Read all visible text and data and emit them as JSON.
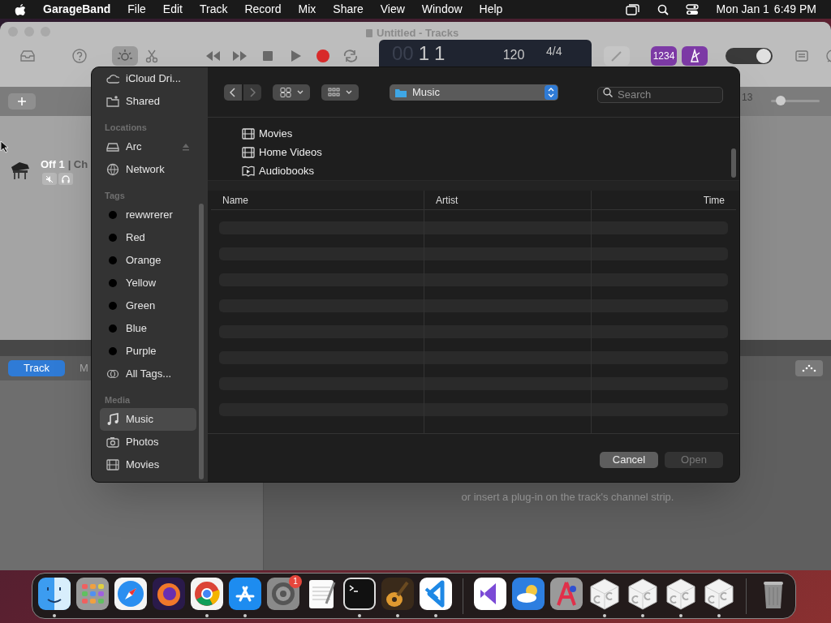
{
  "menubar": {
    "app": "GarageBand",
    "menus": [
      "File",
      "Edit",
      "Track",
      "Record",
      "Mix",
      "Share",
      "View",
      "Window",
      "Help"
    ],
    "date": "Mon Jan 1",
    "time": "6:49 PM"
  },
  "window": {
    "title": "Untitled - Tracks"
  },
  "lcd": {
    "bars_dim": "00",
    "bar": "1",
    "beat": "1",
    "tempo": "120",
    "signature": "4/4"
  },
  "count_in": "1234",
  "toggle": {
    "on": true
  },
  "zoom": {
    "level": 0.12
  },
  "ruler": {
    "bar": "13"
  },
  "track": {
    "name": "Off 1",
    "extra": "| Ch"
  },
  "editor_tabs": [
    {
      "label": "Track",
      "selected": true
    },
    {
      "label": "M",
      "selected": false
    }
  ],
  "editor_hint": "or insert a plug-in on the track's channel strip.",
  "dialog": {
    "sidebar": [
      {
        "items": [
          {
            "kind": "cloud",
            "label": "iCloud Dri...",
            "selected": false
          },
          {
            "kind": "shared",
            "label": "Shared",
            "selected": false
          }
        ]
      },
      {
        "heading": "Locations",
        "items": [
          {
            "kind": "disk",
            "label": "Arc",
            "selected": false,
            "eject": true
          },
          {
            "kind": "network",
            "label": "Network",
            "selected": false
          }
        ]
      },
      {
        "heading": "Tags",
        "items": [
          {
            "kind": "tag",
            "label": "rewwrerer",
            "selected": false
          },
          {
            "kind": "tag",
            "label": "Red",
            "selected": false
          },
          {
            "kind": "tag",
            "label": "Orange",
            "selected": false
          },
          {
            "kind": "tag",
            "label": "Yellow",
            "selected": false
          },
          {
            "kind": "tag",
            "label": "Green",
            "selected": false
          },
          {
            "kind": "tag",
            "label": "Blue",
            "selected": false
          },
          {
            "kind": "tag",
            "label": "Purple",
            "selected": false
          },
          {
            "kind": "alltags",
            "label": "All Tags...",
            "selected": false
          }
        ]
      },
      {
        "heading": "Media",
        "items": [
          {
            "kind": "music",
            "label": "Music",
            "selected": true
          },
          {
            "kind": "photos",
            "label": "Photos",
            "selected": false
          },
          {
            "kind": "movies",
            "label": "Movies",
            "selected": false
          }
        ]
      }
    ],
    "location": "Music",
    "search": {
      "placeholder": "Search"
    },
    "browser": [
      {
        "kind": "film",
        "label": "Movies"
      },
      {
        "kind": "film",
        "label": "Home Videos"
      },
      {
        "kind": "book",
        "label": "Audiobooks"
      }
    ],
    "columns": [
      "Name",
      "Artist",
      "Time"
    ],
    "buttons": [
      {
        "label": "Cancel",
        "disabled": false
      },
      {
        "label": "Open",
        "disabled": true
      }
    ]
  },
  "dock": [
    {
      "kind": "finder",
      "running": true
    },
    {
      "kind": "launchpad",
      "running": false
    },
    {
      "kind": "safari",
      "running": false
    },
    {
      "kind": "firefox",
      "running": false
    },
    {
      "kind": "chrome",
      "running": true
    },
    {
      "kind": "appstore",
      "running": true
    },
    {
      "kind": "settings",
      "running": false,
      "badge": "1"
    },
    {
      "kind": "textedit",
      "running": false
    },
    {
      "kind": "terminal",
      "running": true
    },
    {
      "kind": "garageband",
      "running": true
    },
    {
      "kind": "vscode",
      "running": true
    },
    {
      "kind": "separator"
    },
    {
      "kind": "visualstudio",
      "running": false
    },
    {
      "kind": "weather",
      "running": false
    },
    {
      "kind": "astro",
      "running": false
    },
    {
      "kind": "cube",
      "running": true
    },
    {
      "kind": "cube",
      "running": true
    },
    {
      "kind": "cube",
      "running": true
    },
    {
      "kind": "cube",
      "running": true
    },
    {
      "kind": "separator"
    },
    {
      "kind": "trash",
      "running": false
    }
  ]
}
